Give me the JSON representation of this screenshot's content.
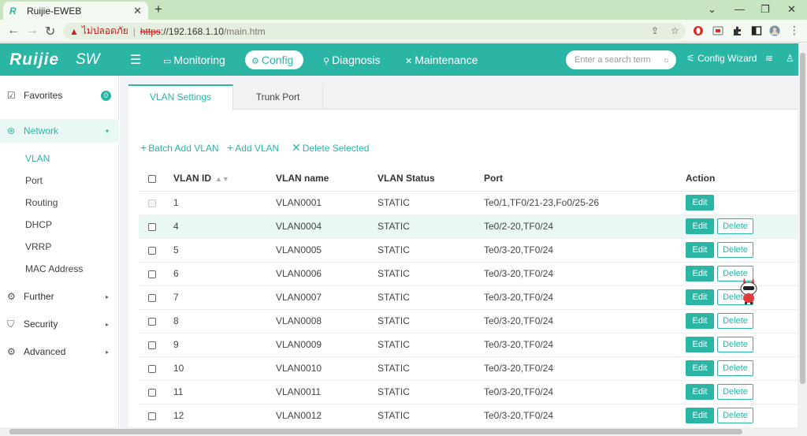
{
  "browser": {
    "tab_title": "Ruijie-EWEB",
    "tab_favicon": "R",
    "security_label": "ไม่ปลอดภัย",
    "url_scheme": "https",
    "url_host": "://192.168.1.10",
    "url_path": "/main.htm"
  },
  "header": {
    "logo": "Ruijie",
    "product": "SW",
    "nav": [
      {
        "label": "Monitoring"
      },
      {
        "label": "Config"
      },
      {
        "label": "Diagnosis"
      },
      {
        "label": "Maintenance"
      }
    ],
    "search_placeholder": "Enter a search term",
    "config_wizard": "Config Wizard"
  },
  "sidebar": {
    "favorites": {
      "label": "Favorites",
      "count": "0"
    },
    "network": {
      "label": "Network"
    },
    "network_items": [
      "VLAN",
      "Port",
      "Routing",
      "DHCP",
      "VRRP",
      "MAC Address"
    ],
    "further": {
      "label": "Further"
    },
    "security": {
      "label": "Security"
    },
    "advanced": {
      "label": "Advanced"
    }
  },
  "tabs": [
    "VLAN Settings",
    "Trunk Port"
  ],
  "toolbar": {
    "batch_add": "Batch Add VLAN",
    "add": "Add VLAN",
    "delete_selected": "Delete Selected"
  },
  "table": {
    "headers": [
      "VLAN ID",
      "VLAN name",
      "VLAN Status",
      "Port",
      "Action"
    ],
    "edit_label": "Edit",
    "delete_label": "Delete",
    "rows": [
      {
        "id": "1",
        "name": "VLAN0001",
        "status": "STATIC",
        "port": "Te0/1,TF0/21-23,Fo0/25-26"
      },
      {
        "id": "4",
        "name": "VLAN0004",
        "status": "STATIC",
        "port": "Te0/2-20,TF0/24"
      },
      {
        "id": "5",
        "name": "VLAN0005",
        "status": "STATIC",
        "port": "Te0/3-20,TF0/24"
      },
      {
        "id": "6",
        "name": "VLAN0006",
        "status": "STATIC",
        "port": "Te0/3-20,TF0/24"
      },
      {
        "id": "7",
        "name": "VLAN0007",
        "status": "STATIC",
        "port": "Te0/3-20,TF0/24"
      },
      {
        "id": "8",
        "name": "VLAN0008",
        "status": "STATIC",
        "port": "Te0/3-20,TF0/24"
      },
      {
        "id": "9",
        "name": "VLAN0009",
        "status": "STATIC",
        "port": "Te0/3-20,TF0/24"
      },
      {
        "id": "10",
        "name": "VLAN0010",
        "status": "STATIC",
        "port": "Te0/3-20,TF0/24"
      },
      {
        "id": "11",
        "name": "VLAN0011",
        "status": "STATIC",
        "port": "Te0/3-20,TF0/24"
      },
      {
        "id": "12",
        "name": "VLAN0012",
        "status": "STATIC",
        "port": "Te0/3-20,TF0/24"
      }
    ]
  },
  "colors": {
    "accent": "#2bb5a5",
    "browser_frame": "#c9e4c0",
    "row_highlight": "#e9f7f5",
    "insecure": "#c5221f"
  }
}
